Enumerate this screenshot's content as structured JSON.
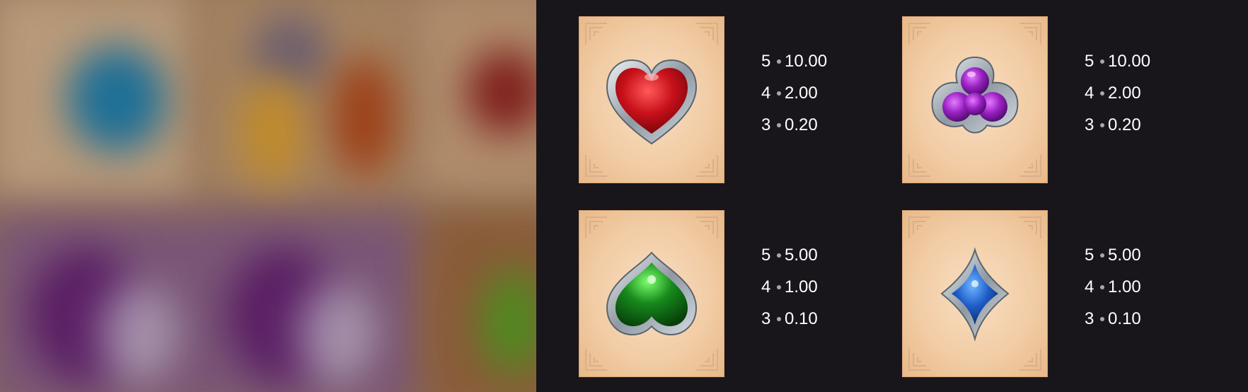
{
  "paytable": {
    "symbols": [
      {
        "name": "Red Heart",
        "icon": "heart-gem-icon",
        "gem_color": "#c8101a",
        "pays": [
          {
            "count": "5",
            "value": "10.00"
          },
          {
            "count": "4",
            "value": "2.00"
          },
          {
            "count": "3",
            "value": "0.20"
          }
        ]
      },
      {
        "name": "Purple Club",
        "icon": "club-gem-icon",
        "gem_color": "#9a22c4",
        "pays": [
          {
            "count": "5",
            "value": "10.00"
          },
          {
            "count": "4",
            "value": "2.00"
          },
          {
            "count": "3",
            "value": "0.20"
          }
        ]
      },
      {
        "name": "Green Spade",
        "icon": "spade-gem-icon",
        "gem_color": "#178a1c",
        "pays": [
          {
            "count": "5",
            "value": "5.00"
          },
          {
            "count": "4",
            "value": "1.00"
          },
          {
            "count": "3",
            "value": "0.10"
          }
        ]
      },
      {
        "name": "Blue Diamond",
        "icon": "diamond-gem-icon",
        "gem_color": "#1f5cc8",
        "pays": [
          {
            "count": "5",
            "value": "5.00"
          },
          {
            "count": "4",
            "value": "1.00"
          },
          {
            "count": "3",
            "value": "0.10"
          }
        ]
      }
    ]
  },
  "colors": {
    "panel_background": "#18161b",
    "card_background": "#f2cda6",
    "text": "#ffffff",
    "separator_dot": "#a9a6ad",
    "metal_frame": "#b7bfc6"
  }
}
